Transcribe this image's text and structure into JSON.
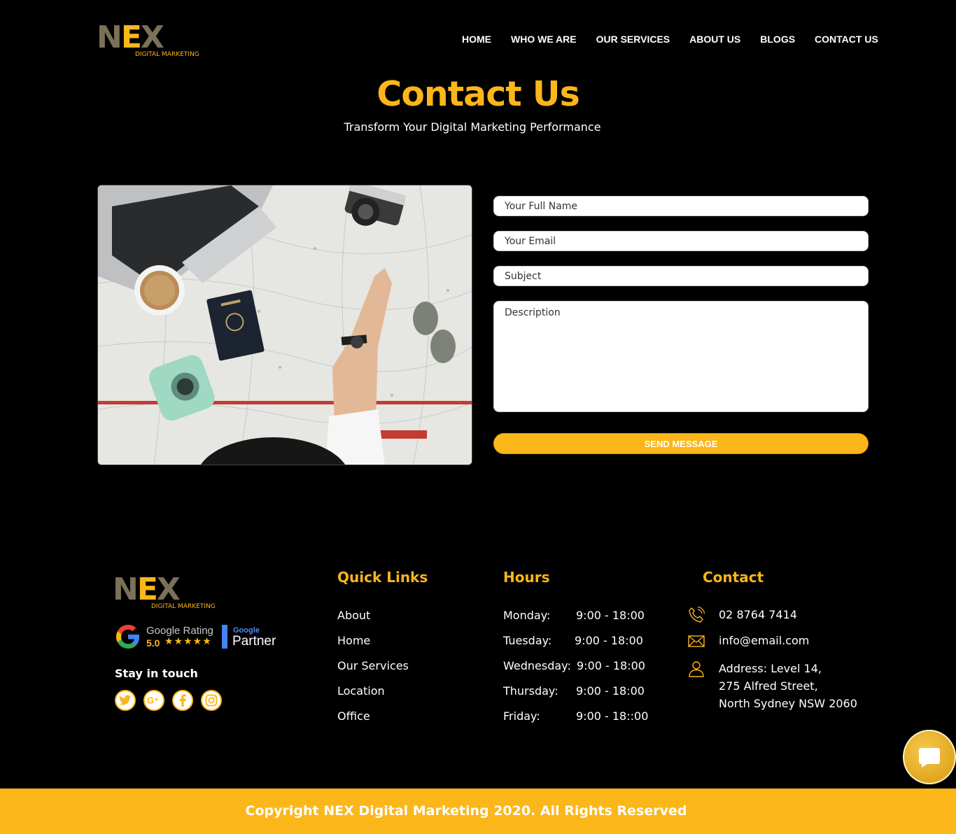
{
  "header": {
    "logo": {
      "letters": [
        "N",
        "E",
        "X"
      ],
      "tagline": "DIGITAL MARKETING"
    },
    "nav": [
      {
        "label": "HOME"
      },
      {
        "label": "WHO WE ARE"
      },
      {
        "label": "OUR SERVICES"
      },
      {
        "label": "ABOUT US"
      },
      {
        "label": "BLOGS"
      },
      {
        "label": "CONTACT US"
      }
    ]
  },
  "hero": {
    "title": "Contact Us",
    "subtitle": "Transform Your Digital Marketing Performance"
  },
  "form": {
    "name_placeholder": "Your Full Name",
    "email_placeholder": "Your Email",
    "subject_placeholder": "Subject",
    "description_placeholder": "Description",
    "send_label": "SEND MESSAGE"
  },
  "footer": {
    "logo": {
      "letters": [
        "N",
        "E",
        "X"
      ],
      "tagline": "DIGITAL MARKETING"
    },
    "google_rating": {
      "label": "Google Rating",
      "score": "5.0",
      "stars": "★★★★★",
      "partner_brand": "Google",
      "partner_label": "Partner"
    },
    "stay_in_touch": "Stay in touch",
    "socials": [
      "twitter-icon",
      "google-plus-icon",
      "facebook-icon",
      "instagram-icon"
    ],
    "quick_links": {
      "title": "Quick Links",
      "items": [
        "About",
        "Home",
        "Our Services",
        "Location",
        "Office"
      ]
    },
    "hours": {
      "title": "Hours",
      "rows": [
        {
          "day": "Monday:",
          "time": "9:00 - 18:00"
        },
        {
          "day": "Tuesday:",
          "time": "9:00 - 18:00"
        },
        {
          "day": "Wednesday:",
          "time": "9:00 - 18:00"
        },
        {
          "day": "Thursday:",
          "time": "9:00 - 18:00"
        },
        {
          "day": "Friday:",
          "time": "9:00 - 18::00"
        }
      ]
    },
    "contact": {
      "title": "Contact",
      "phone": "02 8764 7414",
      "email": "info@email.com",
      "address_lines": [
        "Address: Level 14,",
        "275 Alfred Street,",
        "North Sydney NSW 2060"
      ]
    },
    "copyright": "Copyright NEX Digital Marketing 2020. All Rights Reserved"
  },
  "colors": {
    "accent": "#fbb61a",
    "background": "#000000",
    "logo_gray": "#7b7159"
  }
}
